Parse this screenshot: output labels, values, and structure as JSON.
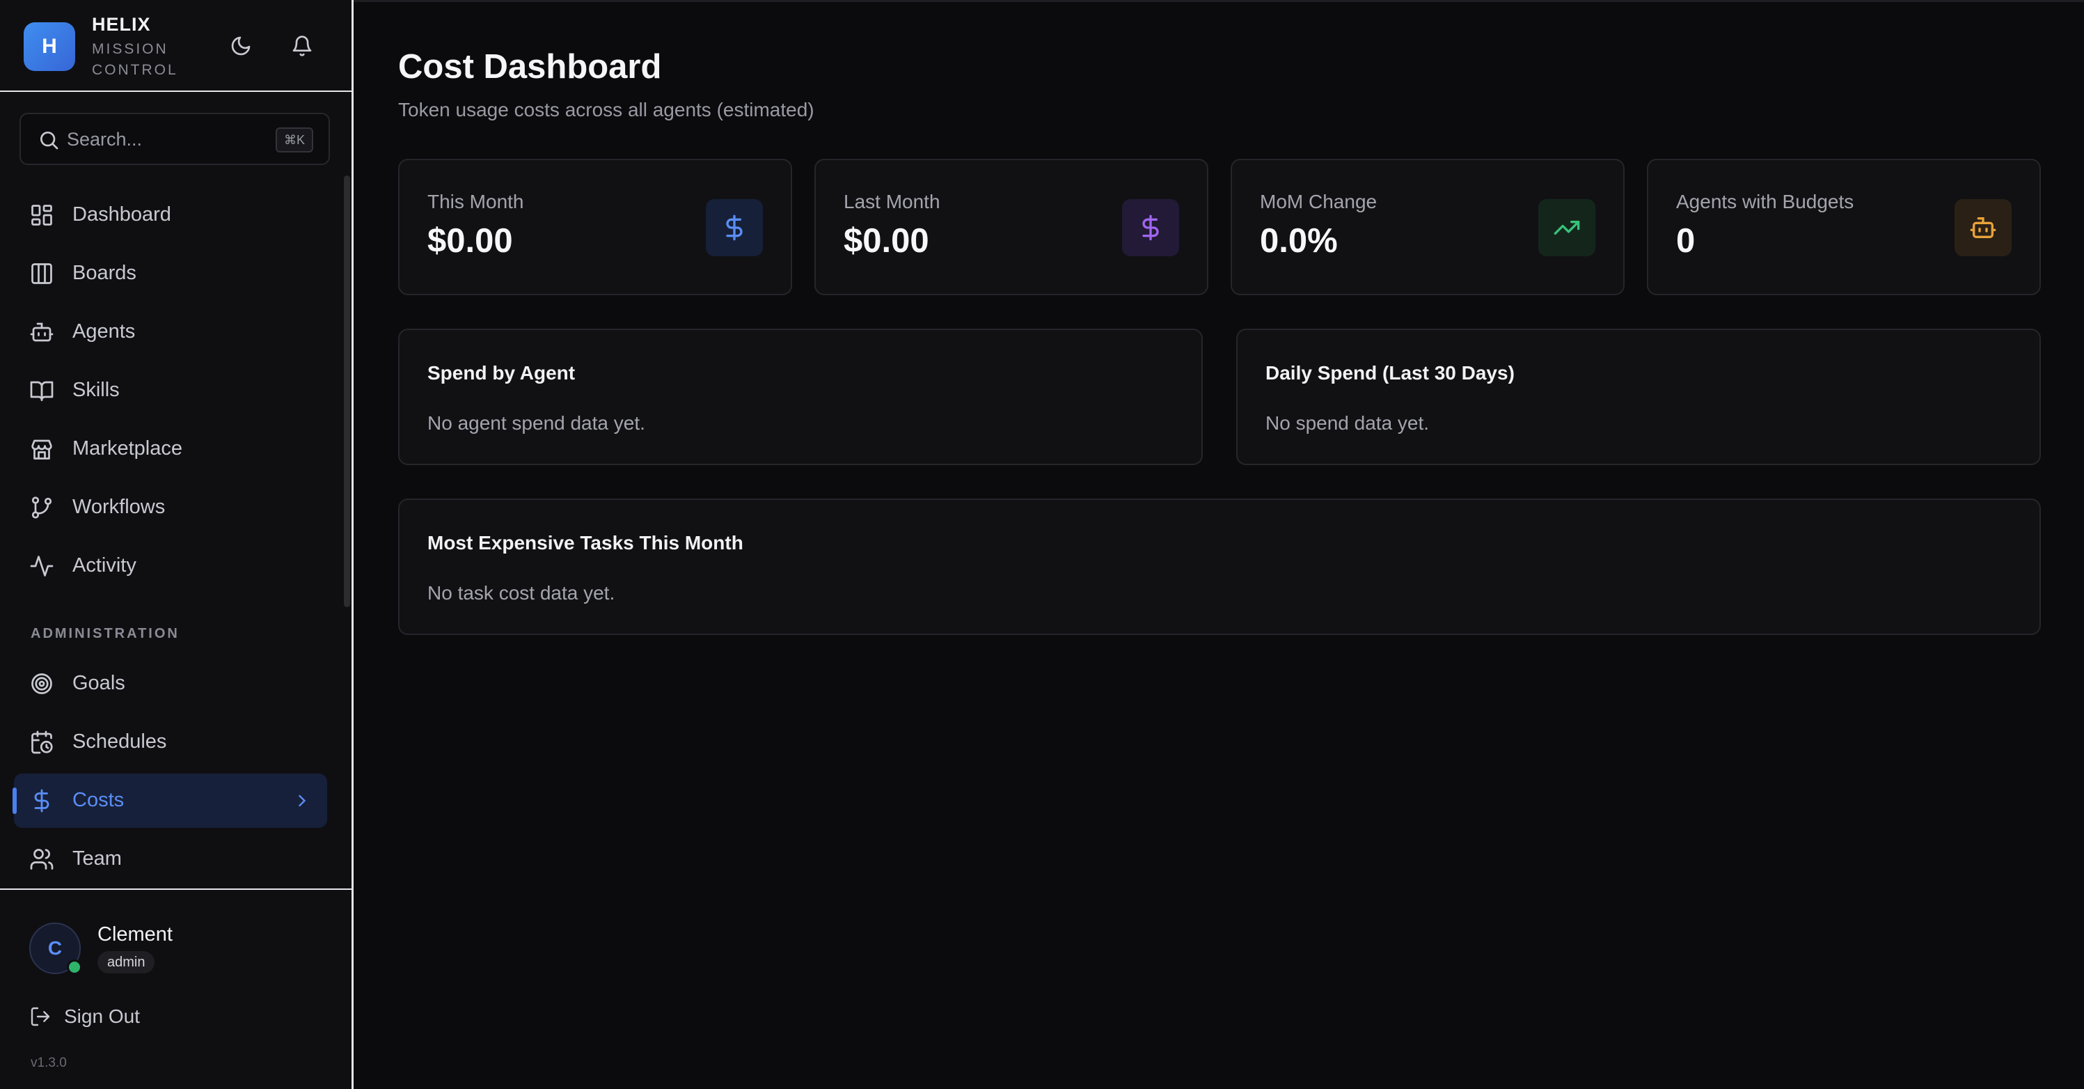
{
  "brand": {
    "logo_letter": "H",
    "name": "HELIX",
    "subtitle": "MISSION CONTROL"
  },
  "header_icons": [
    "moon-icon",
    "bell-icon"
  ],
  "search": {
    "placeholder": "Search...",
    "shortcut": "⌘K"
  },
  "sidebar": {
    "main_items": [
      {
        "label": "Dashboard",
        "icon": "dashboard-icon"
      },
      {
        "label": "Boards",
        "icon": "columns-icon"
      },
      {
        "label": "Agents",
        "icon": "bot-icon"
      },
      {
        "label": "Skills",
        "icon": "book-icon"
      },
      {
        "label": "Marketplace",
        "icon": "store-icon"
      },
      {
        "label": "Workflows",
        "icon": "git-branch-icon"
      },
      {
        "label": "Activity",
        "icon": "activity-icon"
      }
    ],
    "section_label": "ADMINISTRATION",
    "admin_items": [
      {
        "label": "Goals",
        "icon": "target-icon"
      },
      {
        "label": "Schedules",
        "icon": "calendar-clock-icon"
      },
      {
        "label": "Costs",
        "icon": "dollar-icon",
        "active": true
      },
      {
        "label": "Team",
        "icon": "users-icon"
      }
    ]
  },
  "user": {
    "initial": "C",
    "name": "Clement",
    "role": "admin",
    "online": true
  },
  "signout_label": "Sign Out",
  "version": "v1.3.0",
  "page": {
    "title": "Cost Dashboard",
    "subtitle": "Token usage costs across all agents (estimated)"
  },
  "stats": [
    {
      "label": "This Month",
      "value": "$0.00",
      "icon": "dollar-icon",
      "color": "#5a8ef5",
      "bg": "#162038"
    },
    {
      "label": "Last Month",
      "value": "$0.00",
      "icon": "dollar-icon",
      "color": "#a066f0",
      "bg": "#221a36"
    },
    {
      "label": "MoM Change",
      "value": "0.0%",
      "icon": "trending-up-icon",
      "color": "#37c27a",
      "bg": "#14261c"
    },
    {
      "label": "Agents with Budgets",
      "value": "0",
      "icon": "bot-icon",
      "color": "#e8a23a",
      "bg": "#2a2016"
    }
  ],
  "panels": {
    "spend_by_agent": {
      "title": "Spend by Agent",
      "empty": "No agent spend data yet."
    },
    "daily_spend": {
      "title": "Daily Spend (Last 30 Days)",
      "empty": "No spend data yet."
    },
    "expensive_tasks": {
      "title": "Most Expensive Tasks This Month",
      "empty": "No task cost data yet."
    }
  }
}
